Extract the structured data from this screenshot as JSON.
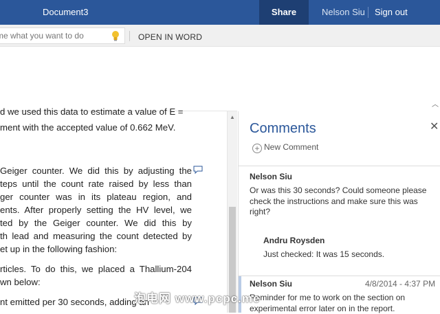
{
  "titlebar": {
    "doc_title": "Document3",
    "share_label": "Share",
    "user_name": "Nelson Siu",
    "signout_label": "Sign out"
  },
  "ribbon": {
    "tellme_placeholder": "me what you want to do",
    "open_in_word_label": "OPEN IN WORD"
  },
  "document": {
    "lines": [
      "d we used this data to estimate a value of E =",
      "ment with the accepted value of 0.662 MeV.",
      "Geiger counter. We did this by adjusting the",
      "teps until the count rate raised by less than",
      "ger counter was in its plateau region, and",
      "ents. After properly setting the HV level, we",
      "ted by the Geiger counter. We did this by",
      "th lead and measuring the count detected by",
      "et up in the following fashion:",
      "rticles. To do this, we placed a Thallium-204",
      "wn below:",
      "nt emitted per 30 seconds, adding an"
    ]
  },
  "comments_pane": {
    "title": "Comments",
    "new_comment_label": "New Comment",
    "comments": [
      {
        "author": "Nelson Siu",
        "text_lines": [
          "Or was this 30 seconds?  Could someone please",
          "check the instructions and make sure this was",
          "right?"
        ]
      },
      {
        "author": "Andru Roysden",
        "text_lines": [
          "Just checked: It was 15 seconds."
        ]
      },
      {
        "author": "Nelson Siu",
        "date": "4/8/2014 - 4:37 PM",
        "text_lines": [
          "Reminder for me to work on the section on",
          "experimental error later on in the report."
        ]
      }
    ]
  },
  "watermark": "泡电网 www.pcpc.me",
  "colors": {
    "titlebar": "#2b579a",
    "share_bg": "#1e3f73",
    "accent_text": "#2b579a",
    "bulb": "#f2c12e"
  }
}
